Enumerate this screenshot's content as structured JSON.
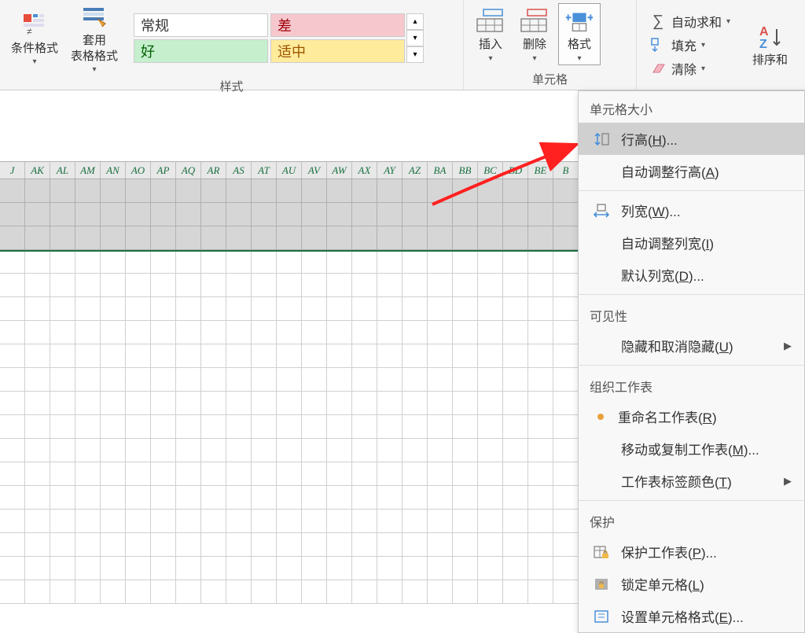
{
  "ribbon": {
    "conditional_format": "条件格式",
    "table_format": "套用\n表格格式",
    "styles_label": "样式",
    "style_cells": {
      "normal": "常规",
      "bad": "差",
      "good": "好",
      "neutral": "适中"
    },
    "insert": "插入",
    "delete": "删除",
    "format": "格式",
    "cells_label": "单元格",
    "autosum": "自动求和",
    "fill": "填充",
    "clear": "清除",
    "sort_filter": "排序和"
  },
  "columns": [
    "J",
    "AK",
    "AL",
    "AM",
    "AN",
    "AO",
    "AP",
    "AQ",
    "AR",
    "AS",
    "AT",
    "AU",
    "AV",
    "AW",
    "AX",
    "AY",
    "AZ",
    "BA",
    "BB",
    "BC",
    "BD",
    "BE",
    "B"
  ],
  "menu": {
    "section_size": "单元格大小",
    "row_height": "行高(H)...",
    "auto_row_height": "自动调整行高(A)",
    "col_width": "列宽(W)...",
    "auto_col_width": "自动调整列宽(I)",
    "default_width": "默认列宽(D)...",
    "section_visibility": "可见性",
    "hide_unhide": "隐藏和取消隐藏(U)",
    "section_organize": "组织工作表",
    "rename_sheet": "重命名工作表(R)",
    "move_copy": "移动或复制工作表(M)...",
    "tab_color": "工作表标签颜色(T)",
    "section_protect": "保护",
    "protect_sheet": "保护工作表(P)...",
    "lock_cell": "锁定单元格(L)",
    "cell_format": "设置单元格格式(E)..."
  }
}
